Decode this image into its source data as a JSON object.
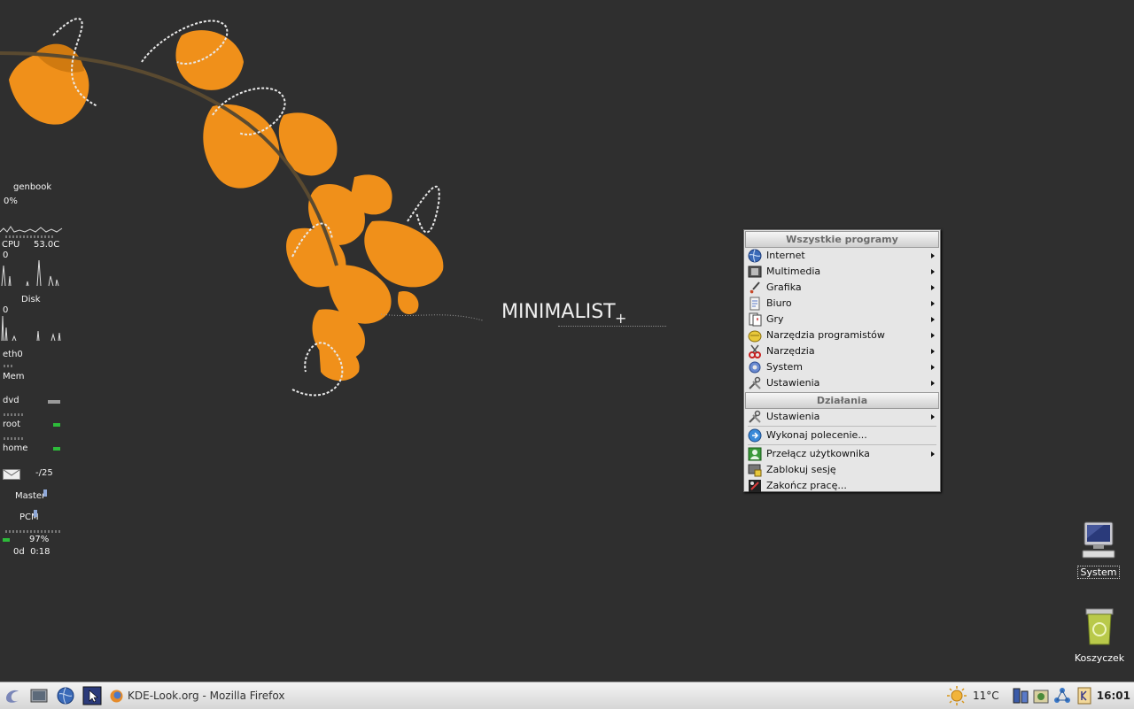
{
  "wallpaper": {
    "brand_text": "MINIMALIST",
    "brand_mark": "+",
    "accent_color": "#f0901a"
  },
  "monitor": {
    "host": "genbook",
    "host_load": "0%",
    "cpu_label": "CPU",
    "cpu_temp": "53.0C",
    "cpu_zero": "0",
    "disk_label": "Disk",
    "disk_zero": "0",
    "net_label": "eth0",
    "mem_label": "Mem",
    "dvd_label": "dvd",
    "root_label": "root",
    "home_label": "home",
    "mail_count": "-/25",
    "master_label": "Master",
    "pcm_label": "PCM",
    "battery_percent": "97%",
    "uptime": "0d  0:18"
  },
  "menu": {
    "header_programs": "Wszystkie programy",
    "programs": [
      {
        "label": "Internet",
        "icon": "globe-icon",
        "submenu": true
      },
      {
        "label": "Multimedia",
        "icon": "film-icon",
        "submenu": true
      },
      {
        "label": "Grafika",
        "icon": "brush-icon",
        "submenu": true
      },
      {
        "label": "Biuro",
        "icon": "document-icon",
        "submenu": true
      },
      {
        "label": "Gry",
        "icon": "cards-icon",
        "submenu": true
      },
      {
        "label": "Narzędzia programistów",
        "icon": "developer-icon",
        "submenu": true
      },
      {
        "label": "Narzędzia",
        "icon": "scissors-icon",
        "submenu": true
      },
      {
        "label": "System",
        "icon": "gear-icon",
        "submenu": true
      },
      {
        "label": "Ustawienia",
        "icon": "tools-icon",
        "submenu": true
      }
    ],
    "header_actions": "Działania",
    "actions": [
      {
        "label": "Ustawienia",
        "icon": "tools-icon",
        "submenu": true
      },
      {
        "label": "Wykonaj polecenie...",
        "icon": "run-icon",
        "submenu": false
      },
      {
        "label": "Przełącz użytkownika",
        "icon": "user-switch-icon",
        "submenu": true
      },
      {
        "label": "Zablokuj sesję",
        "icon": "lock-screen-icon",
        "submenu": false
      },
      {
        "label": "Zakończ pracę...",
        "icon": "logout-icon",
        "submenu": false
      }
    ]
  },
  "desktop": {
    "system_label": "System",
    "trash_label": "Koszyczek"
  },
  "taskbar": {
    "window_title": "KDE-Look.org - Mozilla Firefox",
    "weather_temp": "11°C",
    "clock": "16:01"
  }
}
